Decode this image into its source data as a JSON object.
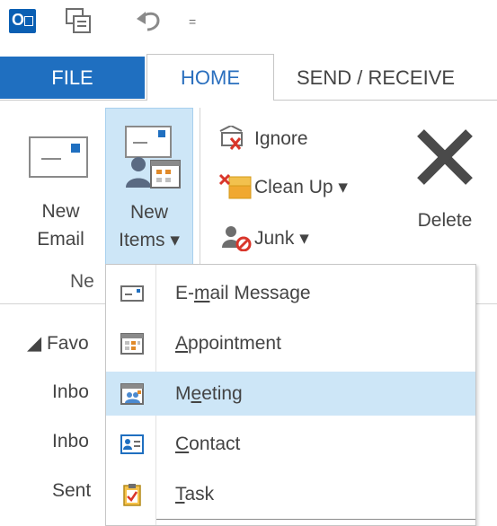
{
  "qat": {
    "outlook_icon": "outlook-icon",
    "sync_icon": "send-receive-all-icon",
    "undo_icon": "undo-icon",
    "customize": "="
  },
  "tabs": {
    "file": "FILE",
    "home": "HOME",
    "send_receive": "SEND / RECEIVE"
  },
  "ribbon": {
    "new_email": {
      "line1": "New",
      "line2": "Email"
    },
    "new_items": {
      "line1": "New",
      "line2": "Items ▾"
    },
    "ignore": "Ignore",
    "clean_up": "Clean Up ▾",
    "junk": "Junk ▾",
    "delete": "Delete",
    "group_label": "Ne"
  },
  "nav_pane": {
    "favorites": "◢ Favo",
    "items": [
      "Inbo",
      "Inbo",
      "Sent"
    ]
  },
  "menu": {
    "items": [
      {
        "pre": "E-",
        "accel": "m",
        "post": "ail Message",
        "icon": "email-message-icon"
      },
      {
        "pre": "",
        "accel": "A",
        "post": "ppointment",
        "icon": "appointment-icon"
      },
      {
        "pre": "M",
        "accel": "e",
        "post": "eting",
        "icon": "meeting-icon",
        "highlighted": true
      },
      {
        "pre": "",
        "accel": "C",
        "post": "ontact",
        "icon": "contact-icon"
      },
      {
        "pre": "",
        "accel": "T",
        "post": "ask",
        "icon": "task-icon"
      }
    ]
  },
  "colors": {
    "accent": "#1f6fc0",
    "highlight": "#cde6f7",
    "text": "#444444"
  }
}
